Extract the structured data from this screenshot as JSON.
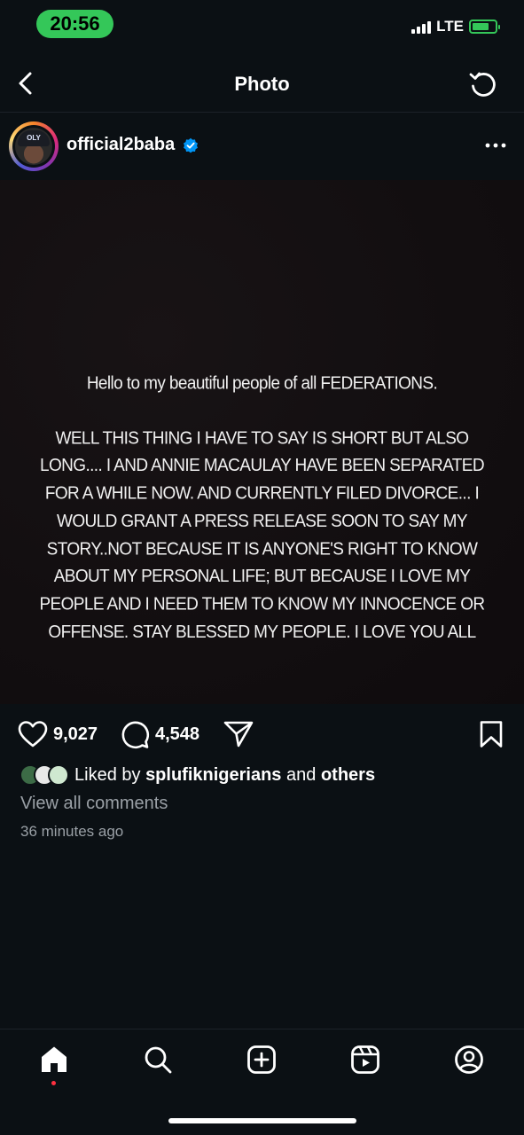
{
  "status_bar": {
    "time": "20:56",
    "network": "LTE"
  },
  "header": {
    "title": "Photo"
  },
  "post": {
    "username": "official2baba",
    "avatar_cap_text": "OLY",
    "greeting": "Hello to my beautiful people of all FEDERATIONS.",
    "body": "WELL THIS THING I HAVE TO SAY IS SHORT BUT ALSO LONG.... I AND ANNIE MACAULAY HAVE BEEN SEPARATED FOR A WHILE NOW. AND CURRENTLY FILED DIVORCE... I WOULD GRANT A PRESS RELEASE SOON TO SAY MY STORY..NOT BECAUSE IT IS ANYONE'S RIGHT TO KNOW ABOUT MY PERSONAL LIFE; BUT BECAUSE I LOVE MY PEOPLE AND I NEED THEM TO KNOW MY INNOCENCE OR OFFENSE. STAY BLESSED MY PEOPLE. I LOVE YOU ALL"
  },
  "actions": {
    "likes_count": "9,027",
    "comments_count": "4,548"
  },
  "engagement": {
    "liked_by_prefix": "Liked by",
    "liked_by_user": "splufiknigerians",
    "liked_by_and": "and",
    "liked_by_others": "others",
    "view_all_comments": "View all comments",
    "time_ago": "36 minutes ago"
  },
  "nav": {
    "items": [
      "home-icon",
      "search-icon",
      "create-icon",
      "reels-icon",
      "profile-icon"
    ]
  },
  "colors": {
    "background": "#0b1014",
    "status_green": "#34c759",
    "verified_blue": "#0095f6",
    "notification_red": "#ff3040"
  }
}
